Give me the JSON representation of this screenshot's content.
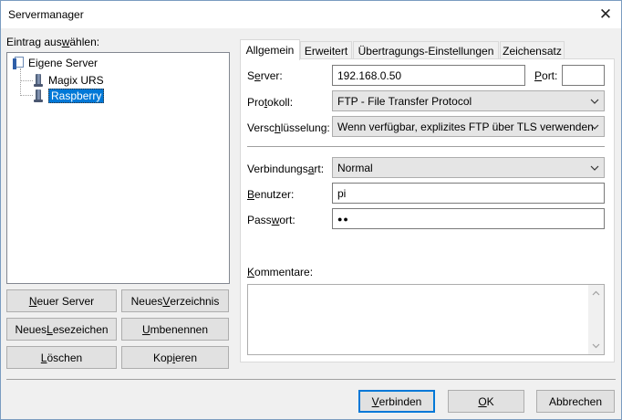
{
  "window": {
    "title": "Servermanager",
    "close_glyph": "✕"
  },
  "left": {
    "label_pre": "Eintrag aus",
    "label_u": "w",
    "label_post": "ählen:",
    "tree": {
      "root": "Eigene Server",
      "children": [
        "Magix URS",
        "Raspberry"
      ],
      "selected": "Raspberry"
    },
    "buttons": {
      "new_server": {
        "u": "N",
        "rest": "euer Server"
      },
      "new_dir": {
        "pre": "Neues ",
        "u": "V",
        "rest": "erzeichnis"
      },
      "new_bookmark": {
        "pre": "Neues ",
        "u": "L",
        "rest": "esezeichen"
      },
      "rename": {
        "u": "U",
        "rest": "mbenennen"
      },
      "delete": {
        "u": "L",
        "rest": "öschen"
      },
      "copy": {
        "pre": "Kop",
        "u": "i",
        "rest": "eren"
      }
    }
  },
  "tabs": [
    "Allgemein",
    "Erweitert",
    "Übertragungs-Einstellungen",
    "Zeichensatz"
  ],
  "active_tab": "Allgemein",
  "form": {
    "server": {
      "label_pre": "S",
      "label_u": "e",
      "label_post": "rver:",
      "value": "192.168.0.50"
    },
    "port": {
      "label_u": "P",
      "label_post": "ort:",
      "value": ""
    },
    "protocol": {
      "label_pre": "Pro",
      "label_u": "t",
      "label_post": "okoll:",
      "value": "FTP - File Transfer Protocol"
    },
    "encryption": {
      "label_pre": "Versc",
      "label_u": "h",
      "label_post": "lüsselung:",
      "value": "Wenn verfügbar, explizites FTP über TLS verwenden"
    },
    "logontype": {
      "label_pre": "Verbindungs",
      "label_u": "a",
      "label_post": "rt:",
      "value": "Normal"
    },
    "user": {
      "label_u": "B",
      "label_post": "enutzer:",
      "value": "pi"
    },
    "password": {
      "label_pre": "Pass",
      "label_u": "w",
      "label_post": "ort:",
      "value": "●●"
    },
    "comments": {
      "label_u": "K",
      "label_post": "ommentare:",
      "value": ""
    }
  },
  "footer": {
    "connect": {
      "u": "V",
      "rest": "erbinden"
    },
    "ok": {
      "u": "O",
      "rest": "K"
    },
    "cancel": "Abbrechen"
  },
  "colors": {
    "accent": "#0078d7",
    "selection": "#0078d7"
  }
}
